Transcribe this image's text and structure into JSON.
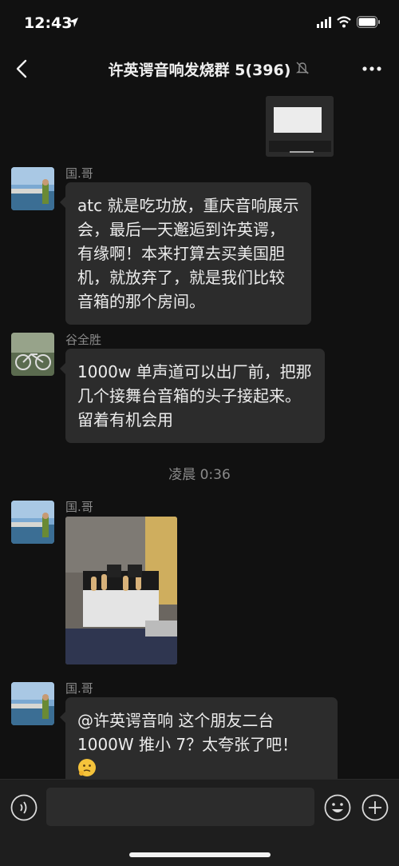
{
  "status_bar": {
    "time": "12:43"
  },
  "nav": {
    "title": "许英谔音响发烧群 5(396)"
  },
  "messages": [
    {
      "sender": "国.哥",
      "text": "atc 就是吃功放，重庆音响展示会，最后一天邂逅到许英谔，有缘啊！本来打算去买美国胆机，就放弃了，就是我们比较音箱的那个房间。"
    },
    {
      "sender": "谷全胜",
      "text": "1000w 单声道可以出厂前，把那几个接舞台音箱的头子接起来。留着有机会用"
    },
    {
      "timestamp": "凌晨 0:36"
    },
    {
      "sender": "国.哥",
      "image": "tube-amplifier-photo"
    },
    {
      "sender": "国.哥",
      "text": "@许英谔音响 这个朋友二台1000W 推小 7？太夸张了吧！"
    }
  ],
  "colors": {
    "background": "#111111",
    "bubble": "#2c2c2c",
    "muted_text": "#8a8a8a"
  }
}
